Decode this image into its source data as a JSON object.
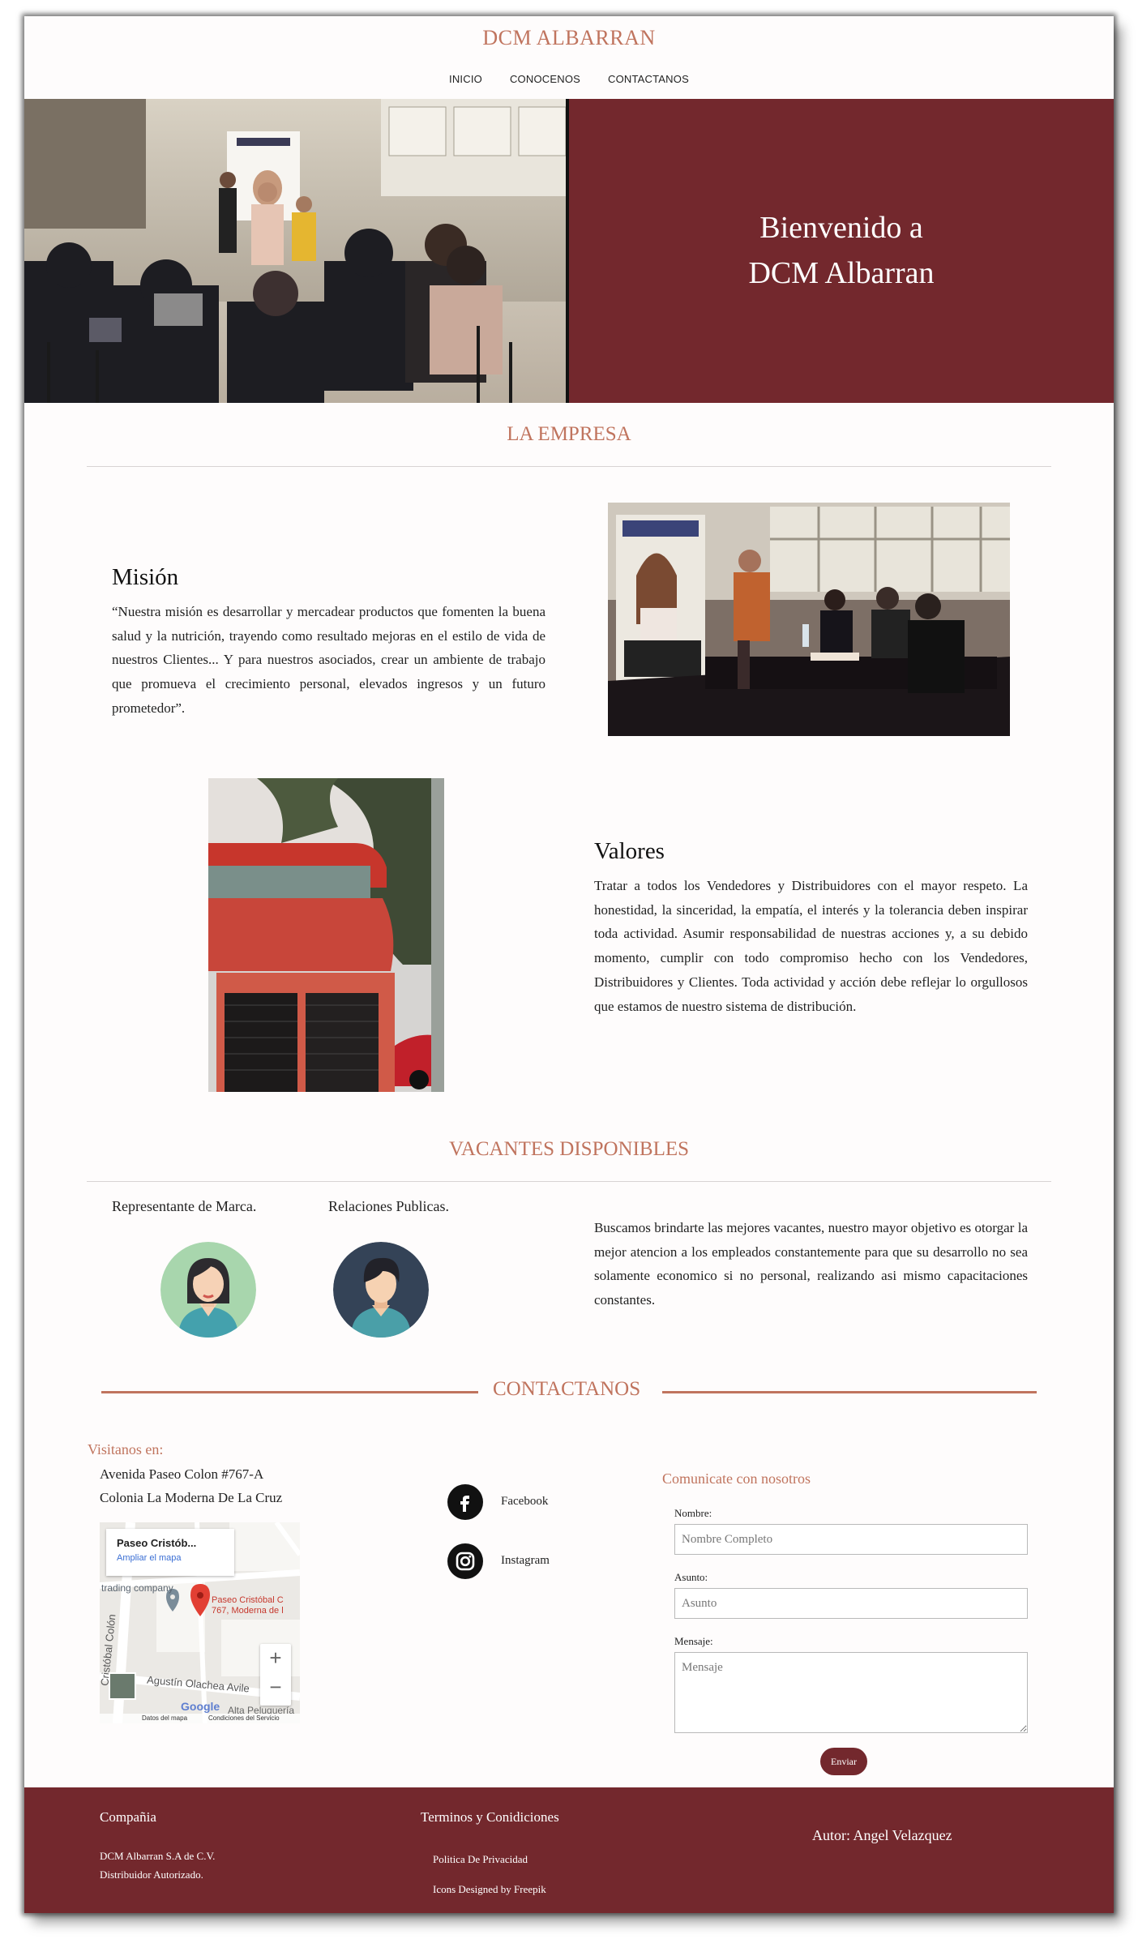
{
  "header": {
    "site_title": "DCM ALBARRAN",
    "nav": [
      "INICIO",
      "CONOCENOS",
      "CONTACTANOS"
    ]
  },
  "hero": {
    "line1": "Bienvenido a",
    "line2": "DCM Albarran"
  },
  "empresa": {
    "title": "LA EMPRESA",
    "mision_title": "Misión",
    "mision_text": "“Nuestra misión es desarrollar y mercadear productos que fomenten la buena salud y la nutrición, trayendo como resultado mejoras en el estilo de vida de nuestros Clientes... Y para nuestros asociados, crear un ambiente de trabajo que promueva el crecimiento personal, elevados ingresos y un futuro prometedor”.",
    "valores_title": "Valores",
    "valores_text": "Tratar a todos los Vendedores y Distribuidores con el mayor respeto. La honestidad, la sinceridad, la empatía, el interés y la tolerancia deben inspirar toda actividad. Asumir responsabilidad de nuestras acciones y, a su debido momento, cumplir con todo compromiso hecho con los Vendedores, Distribuidores y Clientes. Toda actividad y acción debe reflejar lo orgullosos que estamos de nuestro sistema de distribución."
  },
  "vacantes": {
    "title": "VACANTES DISPONIBLES",
    "items": [
      {
        "label": "Representante de Marca.",
        "icon": "female-avatar-icon"
      },
      {
        "label": "Relaciones Publicas.",
        "icon": "male-avatar-icon"
      }
    ],
    "text": "Buscamos brindarte las mejores vacantes, nuestro mayor objetivo es otorgar la mejor atencion a los empleados constantemente para que su desarrollo no sea solamente economico si no personal, realizando asi mismo capacitaciones constantes."
  },
  "contact": {
    "title": "CONTACTANOS",
    "visit_label": "Visitanos en:",
    "address_line1": "Avenida Paseo Colon #767-A",
    "address_line2": "Colonia La Moderna De La Cruz",
    "map": {
      "card_title": "Paseo Cristób...",
      "card_link": "Ampliar el mapa",
      "poi_label": "trading company",
      "pin_label_1": "Paseo Cristóbal C",
      "pin_label_2": "767, Moderna de l",
      "street_1": "Cristóbal Colón",
      "street_2": "Agustín Olachea Avile",
      "poi_2": "Alta Peluquería",
      "google": "Google",
      "footer_1": "Datos del mapa",
      "footer_2": "Condiciones del Servicio",
      "zoom_in": "+",
      "zoom_out": "−"
    },
    "social": [
      {
        "label": "Facebook",
        "icon": "facebook-icon"
      },
      {
        "label": "Instagram",
        "icon": "instagram-icon"
      }
    ],
    "form": {
      "heading": "Comunicate con nosotros",
      "name_label": "Nombre:",
      "name_placeholder": "Nombre Completo",
      "subject_label": "Asunto:",
      "subject_placeholder": "Asunto",
      "message_label": "Mensaje:",
      "message_placeholder": "Mensaje",
      "send": "Enviar"
    }
  },
  "footer": {
    "col1_title": "Compañia",
    "col1_line1": "DCM Albarran S.A de C.V.",
    "col1_line2": "Distribuidor Autorizado.",
    "col2_title": "Terminos y Conidiciones",
    "col2_link1": "Politica De Privacidad",
    "col2_link2": "Icons Designed by Freepik",
    "author": "Autor: Angel Velazquez"
  },
  "colors": {
    "accent": "#c0745e",
    "brand": "#73282d"
  }
}
